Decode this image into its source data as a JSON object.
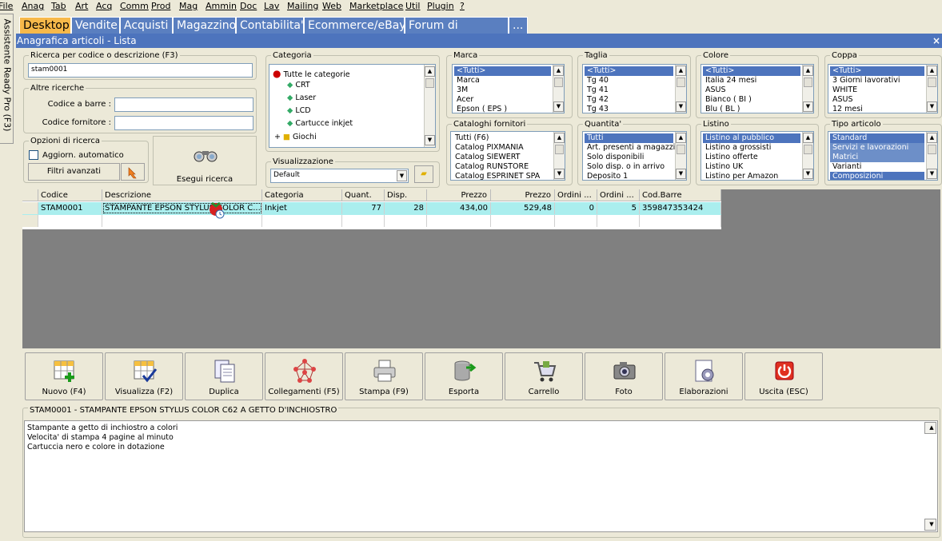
{
  "menu": [
    "File",
    "Anag",
    "Tab",
    "Art",
    "Acq",
    "Comm",
    "Prod",
    "Mag",
    "Ammin",
    "Doc",
    "Lav",
    "Mailing",
    "Web",
    "Marketplace",
    "Util",
    "Plugin",
    "?"
  ],
  "sidebar_label": "Assistente Ready Pro (F3)",
  "tabs": [
    "Desktop",
    "Vendite",
    "Acquisti",
    "Magazzino",
    "Contabilita'",
    "Ecommerce/eBay",
    "Forum di supporto",
    "..."
  ],
  "window_title": "Anagrafica articoli  - Lista",
  "close_glyph": "×",
  "search": {
    "legend": "Ricerca per codice o descrizione (F3)",
    "value": "stam0001",
    "altre_legend": "Altre ricerche",
    "barcode_label": "Codice a barre :",
    "barcode_value": "",
    "supplier_label": "Codice fornitore :",
    "supplier_value": "",
    "opzioni_legend": "Opzioni di ricerca",
    "auto_update_label": "Aggiorn. automatico",
    "advanced_filters_label": "Filtri avanzati",
    "run_search_label": "Esegui ricerca"
  },
  "categoria": {
    "legend": "Categoria",
    "items": [
      "Tutte le categorie",
      "CRT",
      "Laser",
      "LCD",
      "Cartucce inkjet",
      "Giochi"
    ]
  },
  "visualizzazione": {
    "legend": "Visualizzazione",
    "value": "Default"
  },
  "marca": {
    "legend": "Marca",
    "items": [
      "<Tutti>",
      "Marca",
      "3M",
      "Acer",
      "Epson ( EPS )"
    ]
  },
  "taglia": {
    "legend": "Taglia",
    "items": [
      "<Tutti>",
      "Tg 40",
      "Tg 41",
      "Tg 42",
      "Tg 43"
    ]
  },
  "colore": {
    "legend": "Colore",
    "items": [
      "<Tutti>",
      "Italia 24 mesi",
      "ASUS",
      "Bianco ( BI )",
      "Blu ( BL )"
    ]
  },
  "coppa": {
    "legend": "Coppa",
    "items": [
      "<Tutti>",
      "3 Giorni lavorativi",
      "WHITE",
      "ASUS",
      "12 mesi"
    ]
  },
  "cataloghi": {
    "legend": "Cataloghi fornitori",
    "items": [
      "Tutti (F6)",
      "Catalog PIXMANIA",
      "Catalog SIEWERT",
      "Catalog RUNSTORE",
      "Catalog ESPRINET SPA"
    ]
  },
  "quantita": {
    "legend": "Quantita'",
    "items": [
      "Tutti",
      "Art. presenti a magazzino",
      "Solo disponibili",
      "Solo disp. o in arrivo",
      "Deposito 1"
    ]
  },
  "listino": {
    "legend": "Listino",
    "items": [
      "Listino al pubblico",
      "Listino a grossisti",
      "Listino offerte",
      "Listino UK",
      "Listino per Amazon"
    ]
  },
  "tipo": {
    "legend": "Tipo articolo",
    "items": [
      "Standard",
      "Servizi e lavorazioni",
      "Matrici",
      "Varianti",
      "Composizioni"
    ]
  },
  "grid": {
    "headers": [
      "Codice",
      "Descrizione",
      "Categoria",
      "Quant.",
      "Disp.",
      "Prezzo",
      "Prezzo",
      "Ordini ...",
      "Ordini ...",
      "Cod.Barre"
    ],
    "rows": [
      [
        "STAM0001",
        "STAMPANTE EPSON STYLUS COLOR C...",
        "Inkjet",
        "77",
        "28",
        "434,00",
        "529,48",
        "0",
        "5",
        "359847353424"
      ]
    ]
  },
  "toolbar": [
    "Nuovo (F4)",
    "Visualizza (F2)",
    "Duplica",
    "Collegamenti (F5)",
    "Stampa (F9)",
    "Esporta",
    "Carrello",
    "Foto",
    "Elaborazioni",
    "Uscita (ESC)"
  ],
  "memo": {
    "title": "STAM0001 - STAMPANTE EPSON STYLUS COLOR C62 A GETTO D'INCHIOSTRO",
    "lines": [
      "Stampante a getto di inchiostro a colori",
      "Velocita' di stampa 4 pagine al minuto",
      "Cartuccia nero e colore in dotazione"
    ]
  }
}
